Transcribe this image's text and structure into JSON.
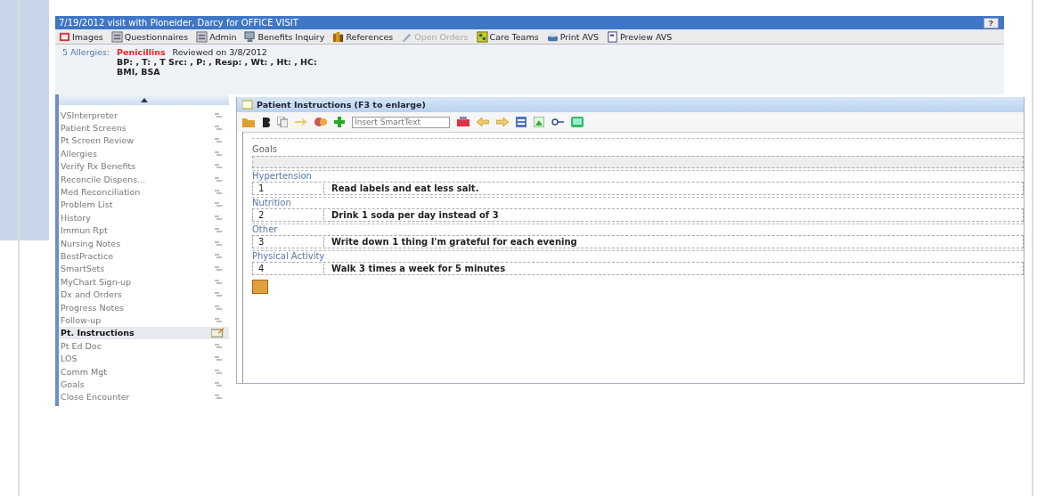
{
  "window": {
    "title": "7/19/2012 visit with Pioneider, Darcy for OFFICE VISIT",
    "help_button": "?"
  },
  "toolbar": [
    {
      "label": "Images",
      "kind": "images",
      "disabled": false
    },
    {
      "label": "Questionnaires",
      "kind": "form",
      "disabled": false
    },
    {
      "label": "Admin",
      "kind": "form",
      "disabled": false
    },
    {
      "label": "Benefits Inquiry",
      "kind": "computer",
      "disabled": false
    },
    {
      "label": "References",
      "kind": "books",
      "disabled": false
    },
    {
      "label": "Open Orders",
      "kind": "pen",
      "disabled": true
    },
    {
      "label": "Care Teams",
      "kind": "team",
      "disabled": false
    },
    {
      "label": "Print AVS",
      "kind": "printer",
      "disabled": false
    },
    {
      "label": "Preview AVS",
      "kind": "page",
      "disabled": false
    }
  ],
  "header": {
    "allergies_label": "5 Allergies:",
    "allergy": "Penicillins",
    "reviewed": "Reviewed on 3/8/2012",
    "vitals": "BP: , T: , T Src: , P: , Resp: , Wt: , Ht: , HC:",
    "vitals_2": "BMI, BSA"
  },
  "sidebar": {
    "items": [
      {
        "label": "VSInterpreter",
        "selected": false
      },
      {
        "label": "Patient Screens",
        "selected": false
      },
      {
        "label": "Pt Screen Review",
        "selected": false
      },
      {
        "label": "Allergies",
        "selected": false
      },
      {
        "label": "Verify Rx Benefits",
        "selected": false
      },
      {
        "label": "Reconcile Dispens...",
        "selected": false
      },
      {
        "label": "Med Reconciliation",
        "selected": false
      },
      {
        "label": "Problem List",
        "selected": false
      },
      {
        "label": "History",
        "selected": false
      },
      {
        "label": "Immun Rpt",
        "selected": false
      },
      {
        "label": "Nursing Notes",
        "selected": false
      },
      {
        "label": "BestPractice",
        "selected": false
      },
      {
        "label": "SmartSets",
        "selected": false
      },
      {
        "label": "MyChart Sign-up",
        "selected": false
      },
      {
        "label": "Dx and Orders",
        "selected": false
      },
      {
        "label": "Progress Notes",
        "selected": false
      },
      {
        "label": "Follow-up",
        "selected": false
      },
      {
        "label": "Pt. Instructions",
        "selected": true
      },
      {
        "label": "Pt Ed Doc",
        "selected": false
      },
      {
        "label": "LOS",
        "selected": false
      },
      {
        "label": "Comm Mgt",
        "selected": false
      },
      {
        "label": "Goals",
        "selected": false
      },
      {
        "label": "Close Encounter",
        "selected": false
      }
    ]
  },
  "panel": {
    "title": "Patient Instructions (F3 to enlarge)",
    "smarttext": {
      "placeholder": "Insert SmartText"
    },
    "goals_heading": "Goals",
    "goals": [
      {
        "category": "Hypertension",
        "number": "1",
        "text": "Read labels and eat less salt."
      },
      {
        "category": "Nutrition",
        "number": "2",
        "text": "Drink 1 soda per day instead of 3"
      },
      {
        "category": "Other",
        "number": "3",
        "text": "Write down 1 thing I'm grateful for each evening"
      },
      {
        "category": "Physical Activity",
        "number": "4",
        "text": "Walk 3 times a week for 5 minutes"
      }
    ]
  }
}
